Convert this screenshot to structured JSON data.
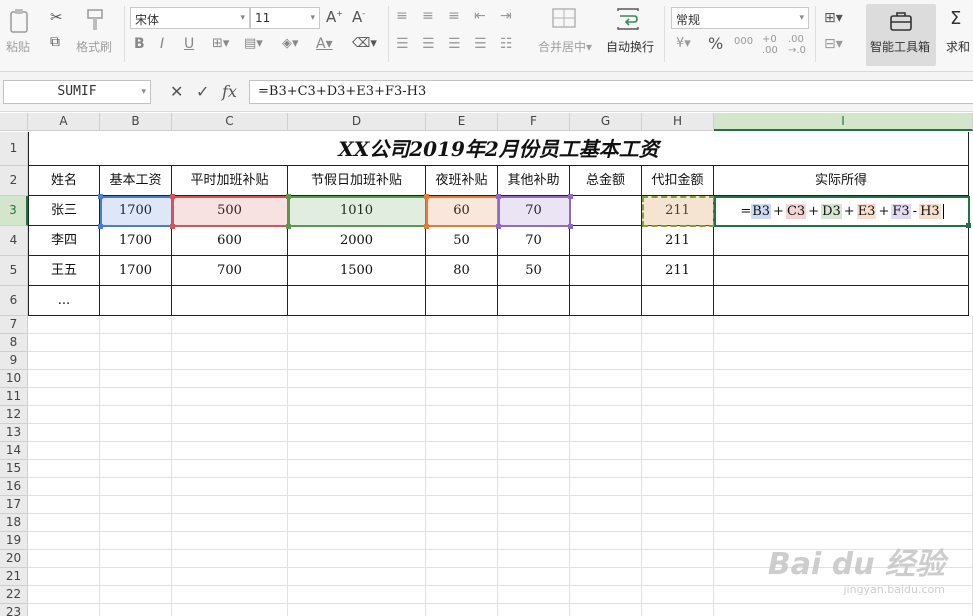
{
  "ribbon": {
    "paste_label": "粘贴",
    "format_painter_label": "格式刷",
    "font_name": "宋体",
    "font_size": "11",
    "merge_center_label": "合并居中",
    "wrap_text_label": "自动换行",
    "number_format": "常规",
    "percent_label": "%",
    "smart_toolbox_label": "智能工具箱",
    "sum_label": "求和"
  },
  "formula_bar": {
    "name_box": "SUMIF",
    "fx_label": "fx",
    "formula": "=B3+C3+D3+E3+F3-H3"
  },
  "sheet": {
    "columns": [
      "A",
      "B",
      "C",
      "D",
      "E",
      "F",
      "G",
      "H",
      "I"
    ],
    "selected_column": "I",
    "selected_row": "3",
    "rows": [
      "1",
      "2",
      "3",
      "4",
      "5",
      "6",
      "7",
      "8",
      "9",
      "10",
      "11",
      "12",
      "13",
      "14",
      "15",
      "16",
      "17",
      "18",
      "19",
      "20",
      "21",
      "22",
      "23"
    ],
    "title": "XX公司2019年2月份员工基本工资",
    "headers": [
      "姓名",
      "基本工资",
      "平时加班补贴",
      "节假日加班补贴",
      "夜班补贴",
      "其他补助",
      "总金额",
      "代扣金额",
      "实际所得"
    ],
    "data": [
      [
        "张三",
        "1700",
        "500",
        "1010",
        "60",
        "70",
        "",
        "211",
        ""
      ],
      [
        "李四",
        "1700",
        "600",
        "2000",
        "50",
        "70",
        "",
        "211",
        ""
      ],
      [
        "王五",
        "1700",
        "700",
        "1500",
        "80",
        "50",
        "",
        "211",
        ""
      ],
      [
        "...",
        "",
        "",
        "",
        "",
        "",
        "",
        "",
        ""
      ]
    ],
    "editing_cell": {
      "prefix": "=",
      "refs": [
        "B3",
        "C3",
        "D3",
        "E3",
        "F3",
        "H3"
      ],
      "ops": [
        "+",
        "+",
        "+",
        "+",
        "-"
      ]
    }
  },
  "colors": {
    "ref_b": "#4a7bd6",
    "ref_c": "#d35656",
    "ref_d": "#5a9a4e",
    "ref_e": "#e67a3c",
    "ref_f": "#8d6cc9",
    "ref_h": "#7aa33a",
    "selection": "#217346"
  },
  "watermark": {
    "brand": "Bai du 经验",
    "url": "jingyan.baidu.com"
  }
}
